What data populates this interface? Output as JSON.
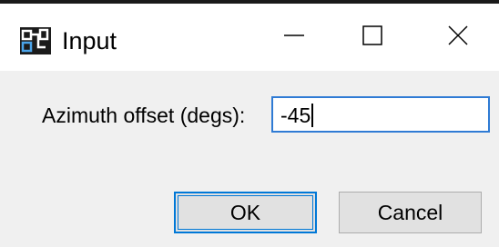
{
  "window": {
    "title": "Input",
    "app_icon": "app-logo-icon",
    "controls": {
      "minimize_icon": "minimize-icon",
      "maximize_icon": "maximize-icon",
      "close_icon": "close-icon"
    }
  },
  "form": {
    "azimuth_label": "Azimuth offset (degs):",
    "azimuth_value": "-45"
  },
  "buttons": {
    "ok_label": "OK",
    "cancel_label": "Cancel"
  },
  "colors": {
    "focus_border": "#0078d7",
    "button_face": "#e1e1e1",
    "dialog_background": "#f0f0f0"
  }
}
